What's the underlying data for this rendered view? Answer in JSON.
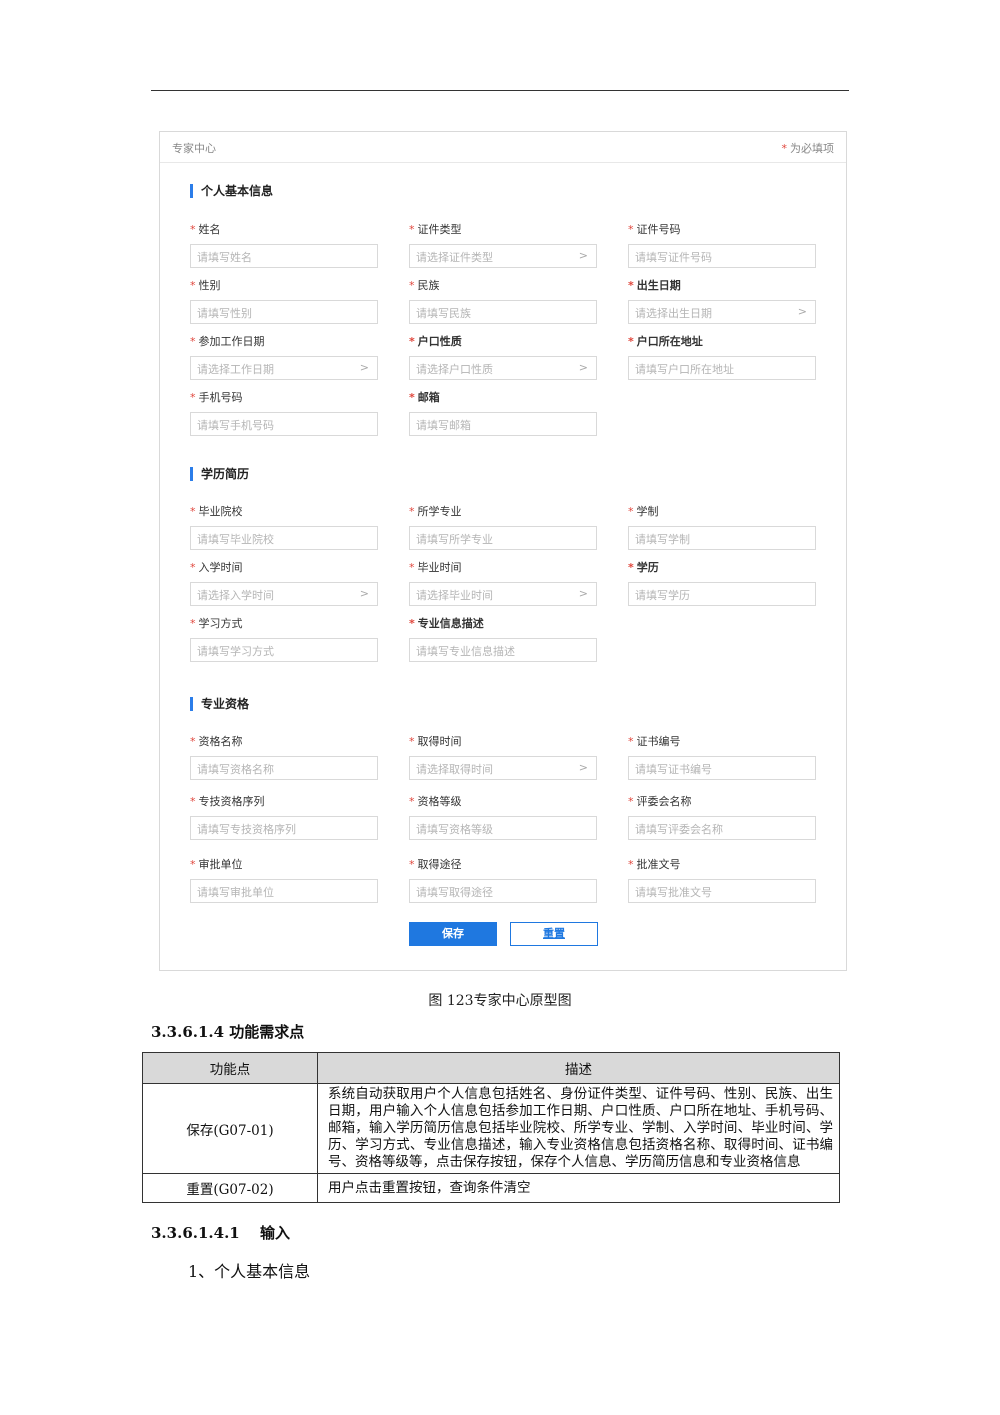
{
  "prototype": {
    "title": "专家中心",
    "required_note": "为必填项",
    "sections": [
      {
        "title": "个人基本信息",
        "fields": [
          {
            "label": "姓名",
            "placeholder": "请填写姓名",
            "select": false,
            "bold": false
          },
          {
            "label": "证件类型",
            "placeholder": "请选择证件类型",
            "select": true,
            "bold": false
          },
          {
            "label": "证件号码",
            "placeholder": "请填写证件号码",
            "select": false,
            "bold": false
          },
          {
            "label": "性别",
            "placeholder": "请填写性别",
            "select": false,
            "bold": false
          },
          {
            "label": "民族",
            "placeholder": "请填写民族",
            "select": false,
            "bold": false
          },
          {
            "label": "出生日期",
            "placeholder": "请选择出生日期",
            "select": true,
            "bold": true
          },
          {
            "label": "参加工作日期",
            "placeholder": "请选择工作日期",
            "select": true,
            "bold": false
          },
          {
            "label": "户口性质",
            "placeholder": "请选择户口性质",
            "select": true,
            "bold": true
          },
          {
            "label": "户口所在地址",
            "placeholder": "请填写户口所在地址",
            "select": false,
            "bold": true
          },
          {
            "label": "手机号码",
            "placeholder": "请填写手机号码",
            "select": false,
            "bold": false
          },
          {
            "label": "邮箱",
            "placeholder": "请填写邮箱",
            "select": false,
            "bold": true
          }
        ]
      },
      {
        "title": "学历简历",
        "fields": [
          {
            "label": "毕业院校",
            "placeholder": "请填写毕业院校",
            "select": false,
            "bold": false
          },
          {
            "label": "所学专业",
            "placeholder": "请填写所学专业",
            "select": false,
            "bold": false
          },
          {
            "label": "学制",
            "placeholder": "请填写学制",
            "select": false,
            "bold": false
          },
          {
            "label": "入学时间",
            "placeholder": "请选择入学时间",
            "select": true,
            "bold": false
          },
          {
            "label": "毕业时间",
            "placeholder": "请选择毕业时间",
            "select": true,
            "bold": false
          },
          {
            "label": "学历",
            "placeholder": "请填写学历",
            "select": false,
            "bold": true
          },
          {
            "label": "学习方式",
            "placeholder": "请填写学习方式",
            "select": false,
            "bold": false
          },
          {
            "label": "专业信息描述",
            "placeholder": "请填写专业信息描述",
            "select": false,
            "bold": true
          }
        ]
      },
      {
        "title": "专业资格",
        "fields": [
          {
            "label": "资格名称",
            "placeholder": "请填写资格名称",
            "select": false,
            "bold": false
          },
          {
            "label": "取得时间",
            "placeholder": "请选择取得时间",
            "select": true,
            "bold": false
          },
          {
            "label": "证书编号",
            "placeholder": "请填写证书编号",
            "select": false,
            "bold": false
          },
          {
            "label": "专技资格序列",
            "placeholder": "请填写专技资格序列",
            "select": false,
            "bold": false
          },
          {
            "label": "资格等级",
            "placeholder": "请填写资格等级",
            "select": false,
            "bold": false
          },
          {
            "label": "评委会名称",
            "placeholder": "请填写评委会名称",
            "select": false,
            "bold": false
          },
          {
            "label": "审批单位",
            "placeholder": "请填写审批单位",
            "select": false,
            "bold": false
          },
          {
            "label": "取得途径",
            "placeholder": "请填写取得途径",
            "select": false,
            "bold": false
          },
          {
            "label": "批准文号",
            "placeholder": "请填写批准文号",
            "select": false,
            "bold": false
          }
        ]
      }
    ],
    "required_mark": "*",
    "select_chevron": ">",
    "save_label": "保存",
    "reset_label": "重置"
  },
  "caption": "图 123专家中心原型图",
  "heading_func": "3.3.6.1.4 功能需求点",
  "table": {
    "headers": [
      "功能点",
      "描述"
    ],
    "rows": [
      {
        "point": "保存(G07-01)",
        "desc": "系统自动获取用户个人信息包括姓名、身份证件类型、证件号码、性别、民族、出生日期，用户输入个人信息包括参加工作日期、户口性质、户口所在地址、手机号码、邮箱，输入学历简历信息包括毕业院校、所学专业、学制、入学时间、毕业时间、学历、学习方式、专业信息描述，输入专业资格信息包括资格名称、取得时间、证书编号、资格等级等，点击保存按钮，保存个人信息、学历简历信息和专业资格信息"
      },
      {
        "point": "重置(G07-02)",
        "desc": "用户点击重置按钮，查询条件清空"
      }
    ]
  },
  "heading_input": "3.3.6.1.4.1　 输入",
  "paragraph": "1、个人基本信息"
}
